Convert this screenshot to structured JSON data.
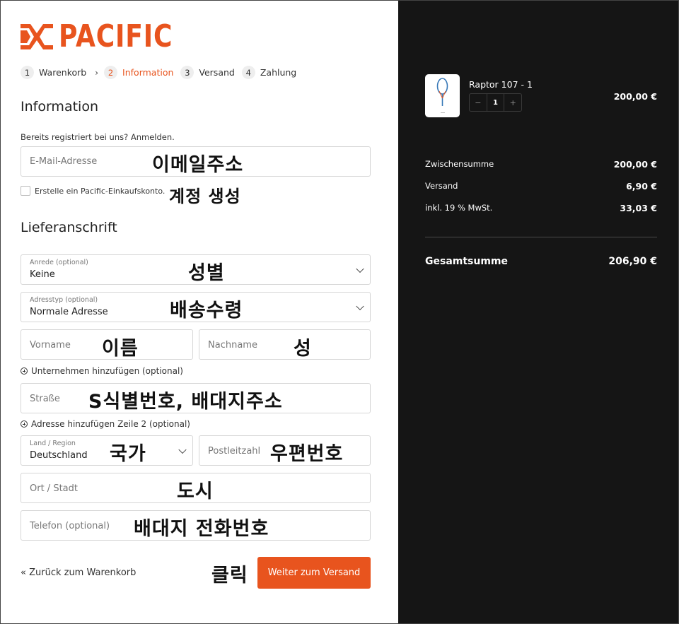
{
  "brand": {
    "name": "PACIFIC",
    "color": "#e8541e"
  },
  "steps": [
    {
      "num": "1",
      "label": "Warenkorb"
    },
    {
      "num": "2",
      "label": "Information"
    },
    {
      "num": "3",
      "label": "Versand"
    },
    {
      "num": "4",
      "label": "Zahlung"
    }
  ],
  "information": {
    "heading": "Information",
    "login_prompt": "Bereits registriert bei uns? Anmelden.",
    "email_placeholder": "E-Mail-Adresse",
    "create_account_label": "Erstelle ein Pacific-Einkaufskonto."
  },
  "shipping": {
    "heading": "Lieferanschrift",
    "salutation": {
      "label": "Anrede (optional)",
      "value": "Keine"
    },
    "address_type": {
      "label": "Adresstyp (optional)",
      "value": "Normale Adresse"
    },
    "first_name_placeholder": "Vorname",
    "last_name_placeholder": "Nachname",
    "add_company": "Unternehmen hinzufügen (optional)",
    "street_placeholder": "Straße",
    "add_line2": "Adresse hinzufügen Zeile 2 (optional)",
    "country": {
      "label": "Land / Region",
      "value": "Deutschland"
    },
    "postal_placeholder": "Postleitzahl",
    "city_placeholder": "Ort / Stadt",
    "phone_placeholder": "Telefon (optional)"
  },
  "actions": {
    "back": "« Zurück zum Warenkorb",
    "continue": "Weiter zum Versand"
  },
  "annotations": {
    "email": "이메일주소",
    "account": "계정 생성",
    "salutation": "성별",
    "address_type": "배송수령",
    "first_name": "이름",
    "last_name": "성",
    "street": "S식별번호, 배대지주소",
    "country": "국가",
    "postal": "우편번호",
    "city": "도시",
    "phone": "배대지 전화번호",
    "click": "클릭"
  },
  "cart": {
    "product_name": "Raptor 107 - 1",
    "quantity": "1",
    "qty_minus": "−",
    "qty_plus": "+",
    "product_price": "200,00 €",
    "subtotal_label": "Zwischensumme",
    "subtotal_value": "200,00 €",
    "shipping_label": "Versand",
    "shipping_value": "6,90 €",
    "tax_label": "inkl. 19 % MwSt.",
    "tax_value": "33,03 €",
    "total_label": "Gesamtsumme",
    "total_value": "206,90 €"
  }
}
